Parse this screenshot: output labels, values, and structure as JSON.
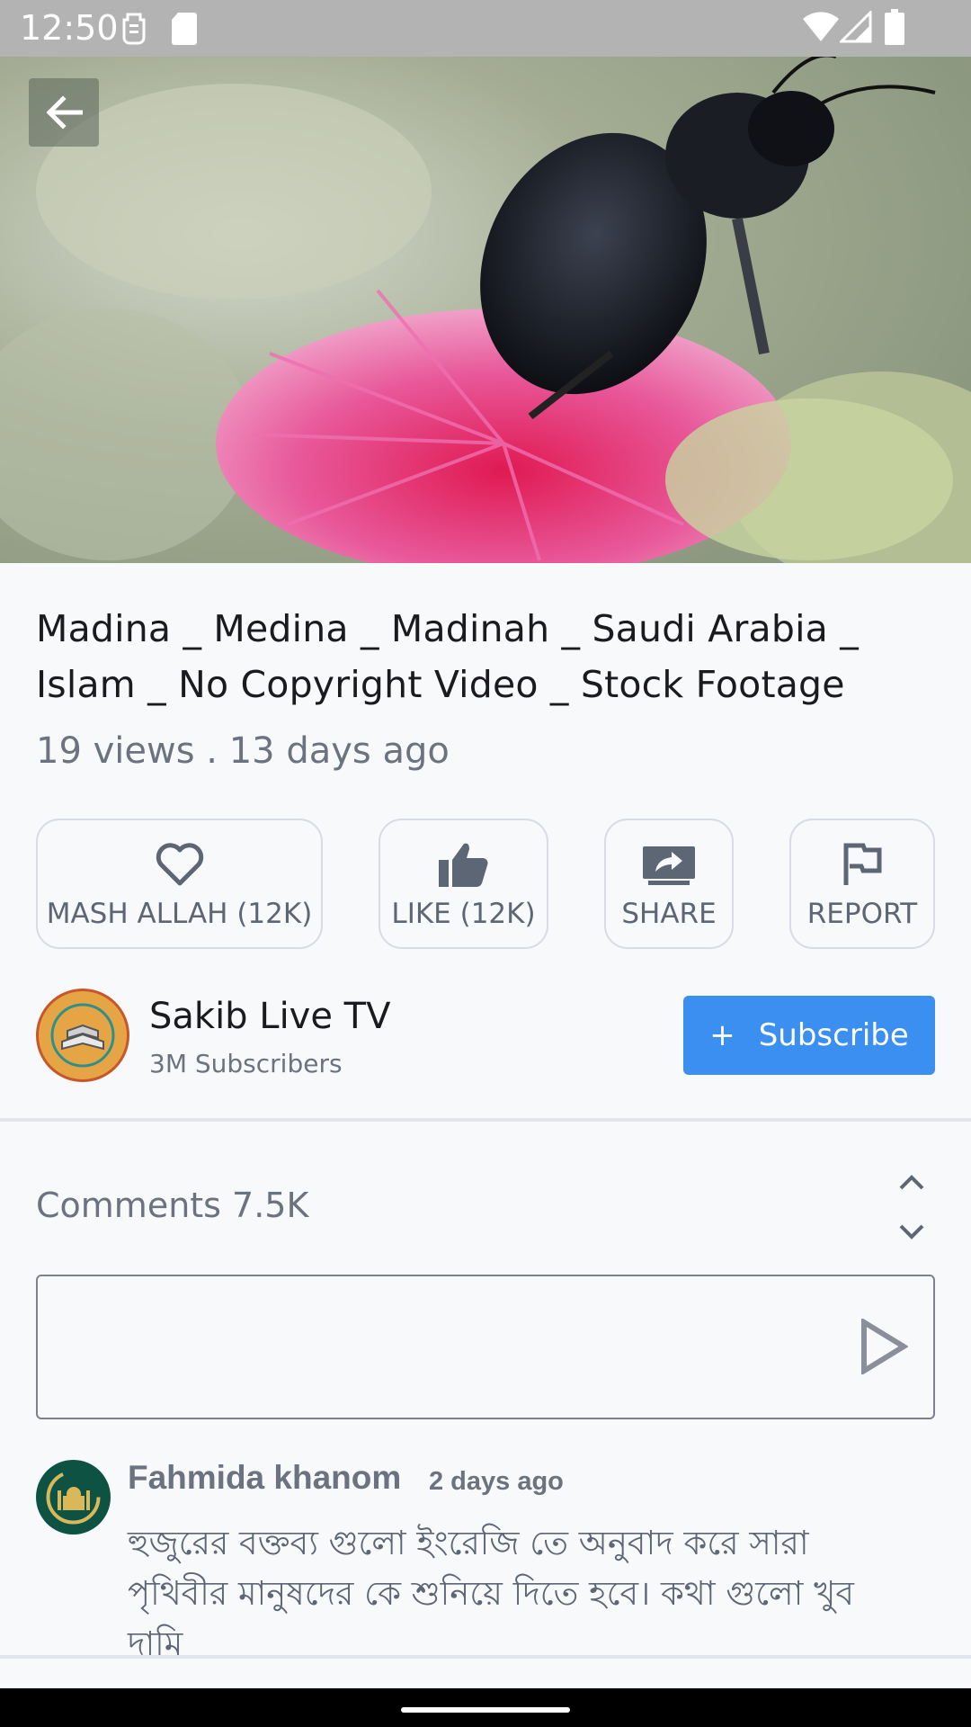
{
  "status_bar": {
    "time": "12:50"
  },
  "video": {
    "back_icon": "arrow-left-icon"
  },
  "video_info": {
    "title": "Madina _ Medina _ Madinah _ Saudi Arabia _ Islam _ No Copyright Video _ Stock Footage",
    "meta": "19 views . 13 days ago"
  },
  "actions": [
    {
      "label": "MASH ALLAH (12K)",
      "icon": "heart-icon"
    },
    {
      "label": "LIKE (12K)",
      "icon": "thumbs-up-icon"
    },
    {
      "label": "SHARE",
      "icon": "share-icon"
    },
    {
      "label": "REPORT",
      "icon": "flag-icon"
    }
  ],
  "channel": {
    "name": "Sakib Live TV",
    "subscribers": "3M Subscribers",
    "subscribe_plus": "+",
    "subscribe_label": "Subscribe"
  },
  "comments": {
    "header": "Comments 7.5K",
    "items": [
      {
        "user": "Fahmida khanom",
        "time": "2 days ago",
        "text": "হুজুরের বক্তব্য গুলো ইংরেজি তে অনুবাদ করে সারা পৃথিবীর মানুষদের কে শুনিয়ে দিতে হবে। কথা গুলো খুব দামি"
      }
    ]
  },
  "colors": {
    "accent": "#3a8ff0",
    "text_primary": "#1b1b1f",
    "text_secondary": "#6b7380",
    "border": "#d7dbe4",
    "status_bar": "#b3b3b3"
  }
}
